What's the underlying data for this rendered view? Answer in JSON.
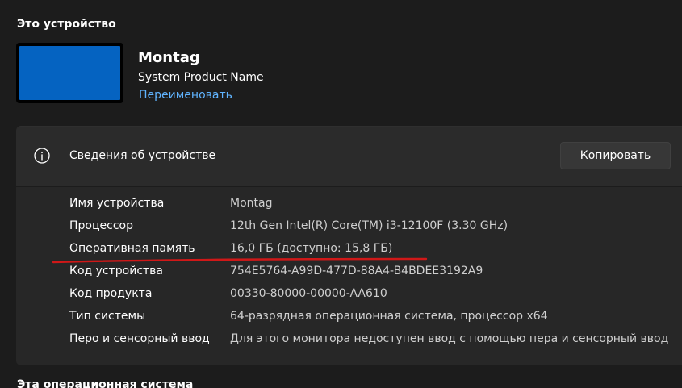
{
  "device_section": {
    "title": "Это устройство",
    "device_name": "Montag",
    "device_model": "System Product Name",
    "rename_link": "Переименовать"
  },
  "specs_card": {
    "title": "Сведения об устройстве",
    "copy_button": "Копировать",
    "info_icon": "info-circle-icon",
    "rows": [
      {
        "label": "Имя устройства",
        "value": "Montag"
      },
      {
        "label": "Процессор",
        "value": "12th Gen Intel(R) Core(TM) i3-12100F (3.30 GHz)"
      },
      {
        "label": "Оперативная память",
        "value": "16,0 ГБ (доступно: 15,8 ГБ)"
      },
      {
        "label": "Код устройства",
        "value": "754E5764-A99D-477D-88A4-B4BDEE3192A9"
      },
      {
        "label": "Код продукта",
        "value": "00330-80000-00000-AA610"
      },
      {
        "label": "Тип системы",
        "value": "64-разрядная операционная система, процессор x64"
      },
      {
        "label": "Перо и сенсорный ввод",
        "value": "Для этого монитора недоступен ввод с помощью пера и сенсорный ввод"
      }
    ]
  },
  "next_section": {
    "title": "Эта операционная система"
  },
  "colors": {
    "background": "#1c1c1c",
    "card": "#272727",
    "link": "#60b4ff",
    "device_screen": "#0563c1",
    "annotation_underline": "#d01818"
  }
}
